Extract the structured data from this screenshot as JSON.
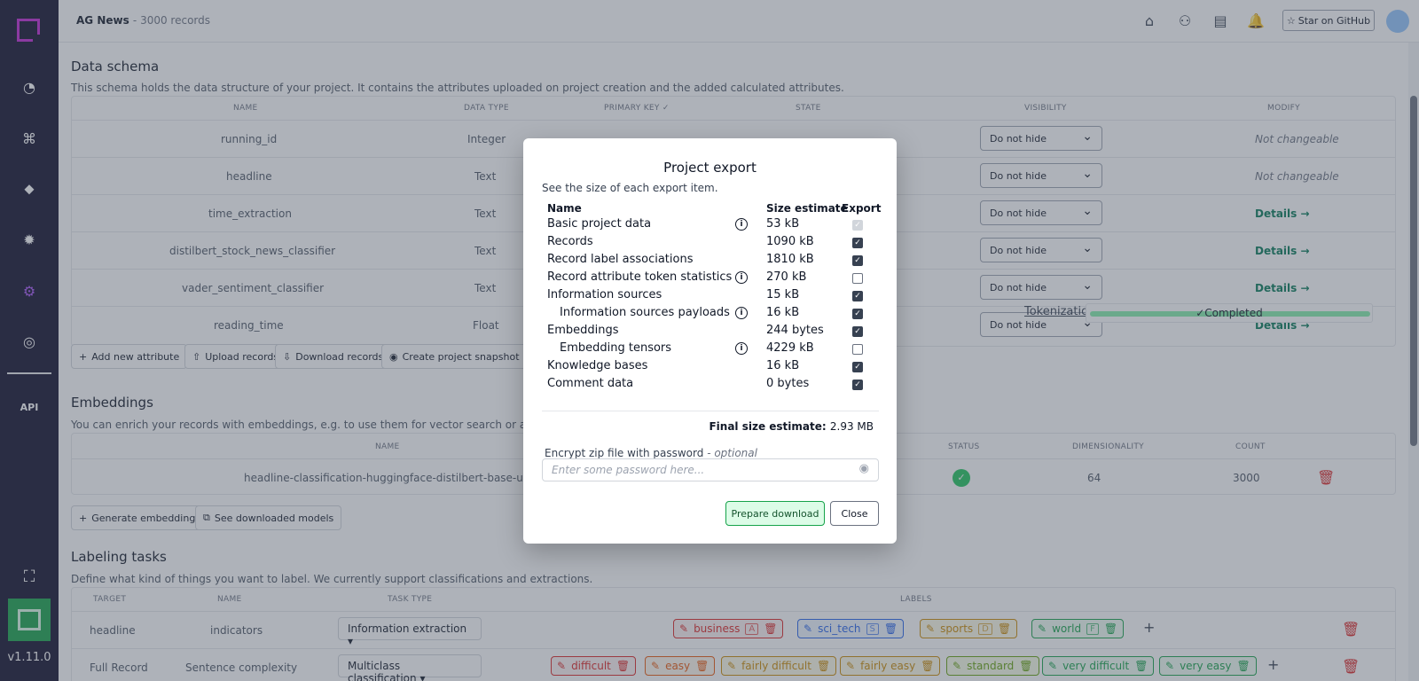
{
  "sidebar": {
    "version": "v1.11.0",
    "api_label": "API",
    "icons": [
      "overview-icon",
      "data-browser-icon",
      "labeling-icon",
      "heuristics-icon",
      "settings-icon",
      "users-icon"
    ]
  },
  "topbar": {
    "project_name": "AG News",
    "record_count": "- 3000 records",
    "github_label": "Star on GitHub"
  },
  "schema": {
    "title": "Data schema",
    "description": "This schema holds the data structure of your project. It contains the attributes uploaded on project creation and the added calculated attributes.",
    "headers": {
      "name": "NAME",
      "type": "DATA TYPE",
      "pk": "PRIMARY KEY ✓",
      "state": "STATE",
      "visibility": "VISIBILITY",
      "modify": "MODIFY"
    },
    "rows": [
      {
        "name": "running_id",
        "type": "Integer",
        "visibility": "Do not hide",
        "modify": "Not changeable"
      },
      {
        "name": "headline",
        "type": "Text",
        "visibility": "Do not hide",
        "modify": "Not changeable"
      },
      {
        "name": "time_extraction",
        "type": "Text",
        "visibility": "Do not hide",
        "modify": "Details →"
      },
      {
        "name": "distilbert_stock_news_classifier",
        "type": "Text",
        "visibility": "Do not hide",
        "modify": "Details →"
      },
      {
        "name": "vader_sentiment_classifier",
        "type": "Text",
        "visibility": "Do not hide",
        "modify": "Details →"
      },
      {
        "name": "reading_time",
        "type": "Float",
        "visibility": "Do not hide",
        "modify": "Details →"
      }
    ],
    "buttons": {
      "add": "Add new attribute",
      "upload": "Upload records",
      "download": "Download records",
      "snapshot": "Create project snapshot"
    },
    "tokenization_label": "Tokenization",
    "tokenization_status": "✓Completed"
  },
  "embeddings": {
    "title": "Embeddings",
    "description": "You can enrich your records with embeddings, e.g. to use them for vector search or active trans",
    "headers": {
      "name": "NAME",
      "status": "STATUS",
      "dim": "DIMENSIONALITY",
      "count": "COUNT"
    },
    "row": {
      "name": "headline-classification-huggingface-distilbert-base-unca",
      "dim": "64",
      "count": "3000"
    },
    "buttons": {
      "generate": "Generate embedding",
      "models": "See downloaded models"
    }
  },
  "labeling": {
    "title": "Labeling tasks",
    "description": "Define what kind of things you want to label. We currently support classifications and extractions.",
    "headers": {
      "target": "TARGET",
      "name": "NAME",
      "type": "TASK TYPE",
      "labels": "LABELS"
    },
    "rows": [
      {
        "target": "headline",
        "name": "indicators",
        "type": "Information extraction",
        "labels": [
          {
            "name": "business",
            "key": "A",
            "color": "#dc2626"
          },
          {
            "name": "sci_tech",
            "key": "S",
            "color": "#2563eb"
          },
          {
            "name": "sports",
            "key": "D",
            "color": "#ca8a04"
          },
          {
            "name": "world",
            "key": "F",
            "color": "#16a34a"
          }
        ]
      },
      {
        "target": "Full Record",
        "name": "Sentence complexity",
        "type": "Multiclass classification",
        "labels": [
          {
            "name": "difficult",
            "color": "#dc2626"
          },
          {
            "name": "easy",
            "color": "#ea580c"
          },
          {
            "name": "fairly difficult",
            "color": "#ca8a04"
          },
          {
            "name": "fairly easy",
            "color": "#ca8a04"
          },
          {
            "name": "standard",
            "color": "#65a30d"
          },
          {
            "name": "very difficult",
            "color": "#16a34a"
          },
          {
            "name": "very easy",
            "color": "#16a34a"
          }
        ]
      }
    ]
  },
  "modal": {
    "title": "Project export",
    "description": "See the size of each export item.",
    "headers": {
      "name": "Name",
      "size": "Size estimate",
      "export": "Export"
    },
    "items": [
      {
        "name": "Basic project data",
        "size": "53 kB",
        "info": true,
        "indent": false,
        "checked": true,
        "disabled": true
      },
      {
        "name": "Records",
        "size": "1090 kB",
        "info": false,
        "indent": false,
        "checked": true,
        "disabled": false
      },
      {
        "name": "Record label associations",
        "size": "1810 kB",
        "info": false,
        "indent": false,
        "checked": true,
        "disabled": false
      },
      {
        "name": "Record attribute token statistics",
        "size": "270 kB",
        "info": true,
        "indent": false,
        "checked": false,
        "disabled": false
      },
      {
        "name": "Information sources",
        "size": "15 kB",
        "info": false,
        "indent": false,
        "checked": true,
        "disabled": false
      },
      {
        "name": "Information sources payloads",
        "size": "16 kB",
        "info": true,
        "indent": true,
        "checked": true,
        "disabled": false
      },
      {
        "name": "Embeddings",
        "size": "244 bytes",
        "info": false,
        "indent": false,
        "checked": true,
        "disabled": false
      },
      {
        "name": "Embedding tensors",
        "size": "4229 kB",
        "info": true,
        "indent": true,
        "checked": false,
        "disabled": false
      },
      {
        "name": "Knowledge bases",
        "size": "16 kB",
        "info": false,
        "indent": false,
        "checked": true,
        "disabled": false
      },
      {
        "name": "Comment data",
        "size": "0 bytes",
        "info": false,
        "indent": false,
        "checked": true,
        "disabled": false
      }
    ],
    "final_label": "Final size estimate:",
    "final_value": "2.93 MB",
    "encrypt_label": "Encrypt zip file with password",
    "encrypt_optional": "- optional",
    "password_placeholder": "Enter some password here...",
    "prepare_label": "Prepare download",
    "close_label": "Close"
  }
}
